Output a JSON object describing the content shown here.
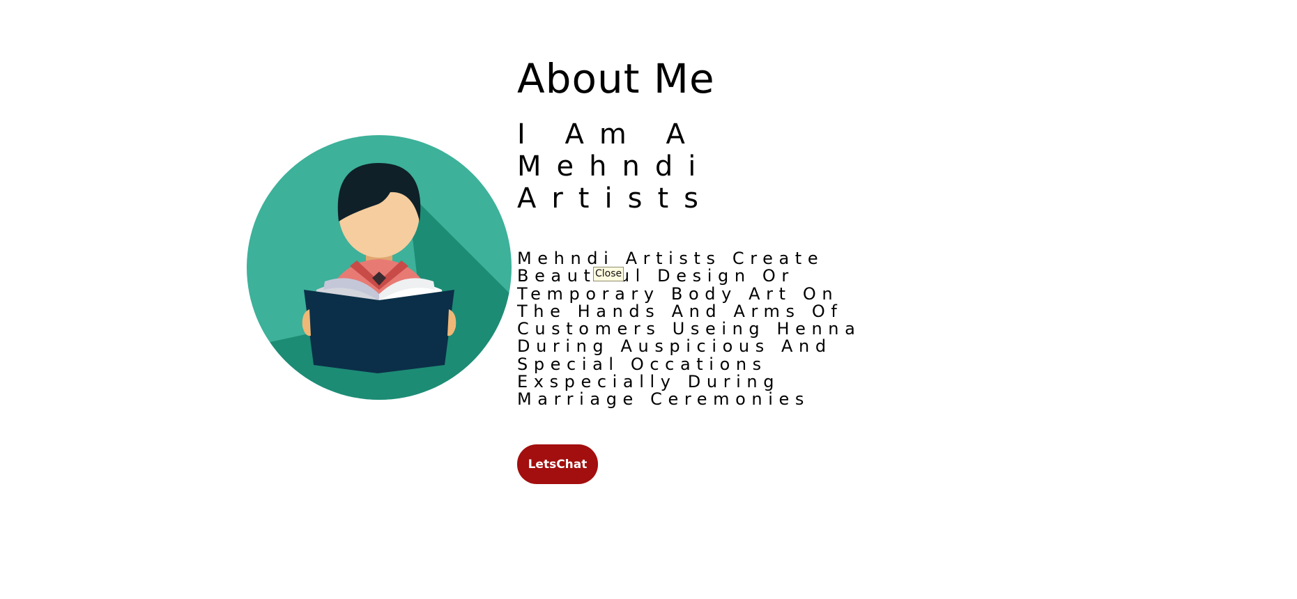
{
  "about": {
    "title": "About Me",
    "subtitle_lines": [
      "I Am A",
      "Mehndi",
      "Artists"
    ],
    "description_lines": [
      "Mehndi Artists Create",
      "Beautiful Design Or",
      "Temporary Body Art On",
      "The Hands And Arms Of",
      "Customers Useing Henna",
      "During Auspicious And",
      "Special Occations",
      "Exspecially During",
      "Marriage Ceremonies"
    ],
    "button_label": "LetsChat"
  },
  "tooltip": {
    "text": "Close"
  },
  "illustration": {
    "icon": "person-reading-book-icon",
    "colors": {
      "circle": "#3db19a",
      "shadow": "#1d8c75",
      "hair": "#0f2028",
      "skin": "#f5cd9f",
      "shirt": "#e87a74",
      "book_cover": "#0b2f48"
    }
  },
  "colors": {
    "background": "#ffffff",
    "text": "#000000",
    "button": "#a30e0e",
    "button_text": "#ffffff"
  }
}
